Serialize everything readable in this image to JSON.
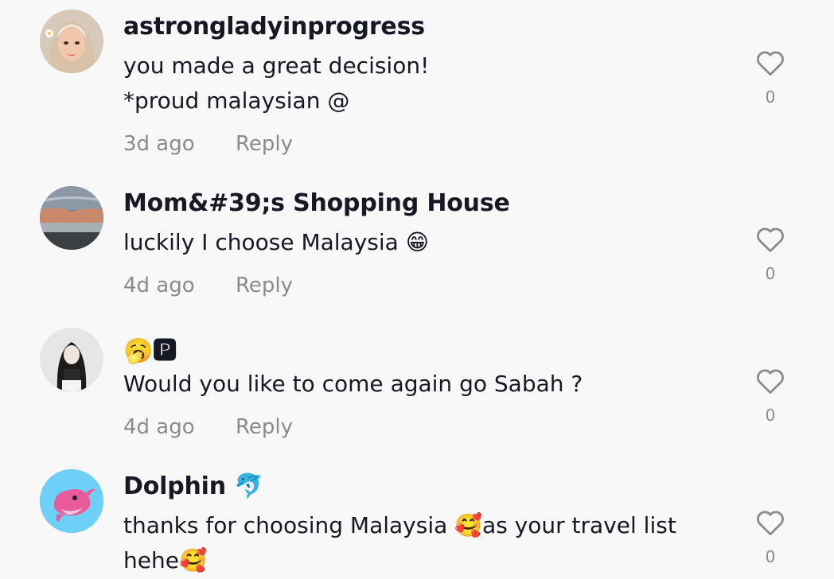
{
  "comments": [
    {
      "username": "astrongladyinprogress",
      "lines": [
        "you made a great decision!",
        "*proud malaysian @"
      ],
      "time": "3d ago",
      "reply_label": "Reply",
      "like_count": "0",
      "avatar_icon": "profile-photo-woman"
    },
    {
      "username": "Mom&#39;s Shopping House",
      "lines": [
        "luckily I choose Malaysia 😁"
      ],
      "time": "4d ago",
      "reply_label": "Reply",
      "like_count": "0",
      "avatar_icon": "profile-photo-sunset"
    },
    {
      "username": "🥱🅿",
      "lines": [
        "Would you like to come again go Sabah ?"
      ],
      "time": "4d ago",
      "reply_label": "Reply",
      "like_count": "0",
      "avatar_icon": "profile-photo-girl"
    },
    {
      "username": "Dolphin 🐬",
      "lines": [
        "thanks for choosing Malaysia 🥰as your travel list",
        "hehe🥰"
      ],
      "like_count": "0",
      "avatar_icon": "dolphin-avatar"
    }
  ],
  "colors": {
    "background": "#f8f8f8",
    "text_primary": "#161823",
    "text_secondary": "#8a8b91",
    "dolphin_avatar_bg": "#6fd0f7"
  }
}
